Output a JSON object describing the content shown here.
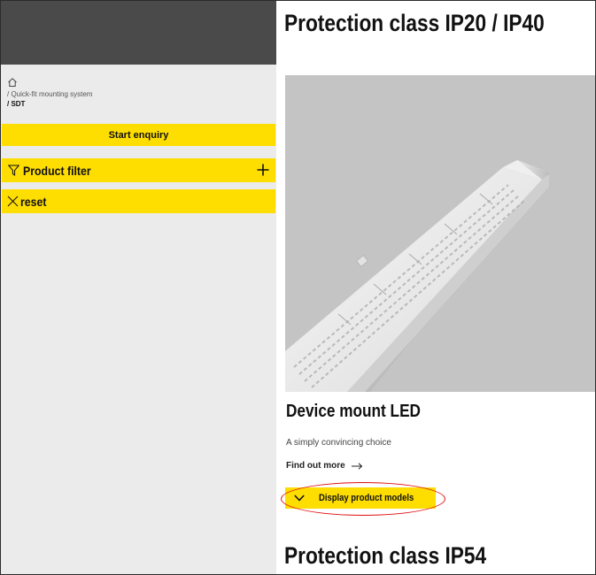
{
  "sidebar": {
    "breadcrumb": {
      "home_icon": "home-icon",
      "items": [
        "/ Quick-fit mounting system",
        "/ SDT"
      ]
    },
    "enquiry_label": "Start enquiry",
    "filter": {
      "icon": "funnel-icon",
      "label": "Product filter",
      "expand_icon": "plus-icon"
    },
    "reset": {
      "icon": "close-icon",
      "label": "reset"
    }
  },
  "main": {
    "section_titles": [
      "Protection class IP20 / IP40",
      "Protection class IP54"
    ],
    "product": {
      "name": "Device mount LED",
      "description": "A simply convincing choice",
      "find_more_label": "Find out more",
      "find_more_icon": "arrow-right-icon",
      "models_label": "Display product models",
      "models_icon": "chevron-down-icon"
    }
  },
  "colors": {
    "accent_yellow": "#fedd00",
    "sidebar_bg": "#ebebeb",
    "sidebar_header": "#4a4a4a",
    "image_bg": "#c4c4c4",
    "annotation_red": "#e01010"
  }
}
